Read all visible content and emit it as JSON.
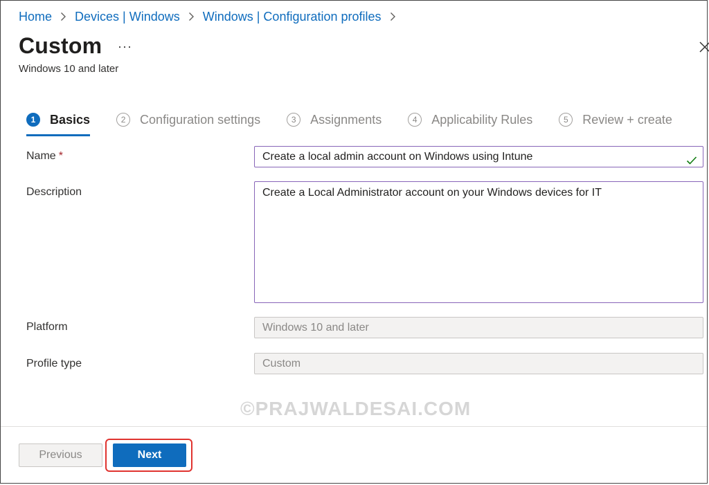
{
  "breadcrumb": {
    "items": [
      "Home",
      "Devices | Windows",
      "Windows | Configuration profiles"
    ]
  },
  "header": {
    "title": "Custom",
    "more_label": "···",
    "subtitle": "Windows 10 and later"
  },
  "wizard": {
    "steps": [
      {
        "num": "1",
        "label": "Basics",
        "active": true
      },
      {
        "num": "2",
        "label": "Configuration settings",
        "active": false
      },
      {
        "num": "3",
        "label": "Assignments",
        "active": false
      },
      {
        "num": "4",
        "label": "Applicability Rules",
        "active": false
      },
      {
        "num": "5",
        "label": "Review + create",
        "active": false
      }
    ]
  },
  "form": {
    "name_label": "Name",
    "required_mark": "*",
    "name_value": "Create a local admin account on Windows using Intune",
    "description_label": "Description",
    "description_value": "Create a Local Administrator account on your Windows devices for IT",
    "platform_label": "Platform",
    "platform_value": "Windows 10 and later",
    "profile_type_label": "Profile type",
    "profile_type_value": "Custom"
  },
  "watermark": "©PRAJWALDESAI.COM",
  "footer": {
    "previous_label": "Previous",
    "next_label": "Next"
  },
  "colors": {
    "accent": "#0f6cbd",
    "focus_border": "#8764b8",
    "highlight": "#e0332f",
    "valid_check": "#107c10"
  },
  "icons": [
    "chevron-right-icon",
    "close-icon",
    "checkmark-icon"
  ]
}
